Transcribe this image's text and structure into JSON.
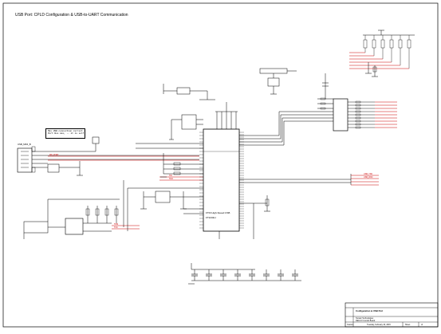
{
  "sheet": {
    "title": "USB Port: CPLD Configuration & USB-to-UART Communication"
  },
  "note": {
    "line1": "Max USB connection current is 500mA (USB",
    "line2": "Port Bus max, -- it is self-protected."
  },
  "chip": {
    "label_main": "FTDI High-Speed USB",
    "label_part": "FT2232H"
  },
  "connector": {
    "label": "USB_MINI_B"
  },
  "signals": {
    "net_red_1": "MD_PORT",
    "net_red_2": "TDI",
    "net_red_3": "TDO",
    "net_red_4": "TMS",
    "net_red_5": "TCK",
    "out_red_1": "USB_TXD",
    "out_red_2": "USB_RXD"
  },
  "title_block": {
    "title": "Configuration & USB Port",
    "company_line1": "Terasic Technologies",
    "company_line2": "DE0-CV Control Board",
    "rev_label": "Custom",
    "date_label": "Tuesday, February 10, 2015",
    "sheet_label": "Sheet",
    "of_label": "of"
  },
  "colors": {
    "line": "#000000",
    "net_red": "#cc0000",
    "paper": "#ffffff"
  }
}
